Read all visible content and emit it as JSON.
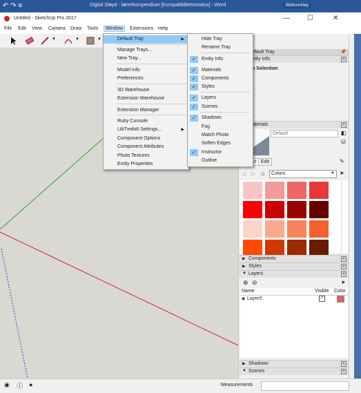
{
  "word_window": {
    "title": "Digital Sløyd - lærerkompendium [Kompatibilitetsmodus] - Word",
    "tools_tab": "Bildeverktøy",
    "quick_access": "↶ ↷ ≡"
  },
  "sketchup_window": {
    "title": "Untitled - SketchUp Pro 2017",
    "minimize": "—",
    "maximize": "☐",
    "close": "✕"
  },
  "menubar": [
    "File",
    "Edit",
    "View",
    "Camera",
    "Draw",
    "Tools",
    "Window",
    "Extensions",
    "Help"
  ],
  "window_menu": {
    "items": [
      {
        "label": "Default Tray",
        "submenu": true,
        "highlighted": true
      },
      {
        "label": "Manage Trays..."
      },
      {
        "label": "New Tray..."
      },
      {
        "label": "Model Info"
      },
      {
        "label": "Preferences"
      },
      {
        "label": "3D Warehouse"
      },
      {
        "label": "Extension Warehouse"
      },
      {
        "label": "Extension Manager"
      },
      {
        "label": "Ruby Console"
      },
      {
        "label": "LibTredo6 Settings...",
        "submenu": true
      },
      {
        "label": "Component Options"
      },
      {
        "label": "Component Attributes"
      },
      {
        "label": "Photo Textures"
      },
      {
        "label": "Entity Properties"
      }
    ]
  },
  "tray_submenu": {
    "items": [
      {
        "label": "Hide Tray",
        "checked": false
      },
      {
        "label": "Rename Tray",
        "checked": false
      },
      {
        "label": "Entity Info",
        "checked": true
      },
      {
        "label": "Materials",
        "checked": true
      },
      {
        "label": "Components",
        "checked": true
      },
      {
        "label": "Styles",
        "checked": true
      },
      {
        "label": "Layers",
        "checked": true
      },
      {
        "label": "Scenes",
        "checked": true
      },
      {
        "label": "Shadows",
        "checked": true
      },
      {
        "label": "Fog",
        "checked": false
      },
      {
        "label": "Match Photo",
        "checked": false
      },
      {
        "label": "Soften Edges",
        "checked": false
      },
      {
        "label": "Instructor",
        "checked": true
      },
      {
        "label": "Outline",
        "checked": false
      }
    ]
  },
  "tray": {
    "title": "Default Tray",
    "entity_info_title": "Entity Info",
    "selection_label": "No Selection",
    "materials_title": "Materials",
    "material_name": "Default",
    "tab_select": "Select",
    "tab_edit": "Edit",
    "colors_dropdown": "Colors",
    "swatch_colors": [
      "#f9c4c4",
      "#f49a9a",
      "#ef6666",
      "#ea3838",
      "#ff0000",
      "#cc0000",
      "#990000",
      "#660000",
      "#fdd3c9",
      "#f9a98f",
      "#f5845f",
      "#f4612f",
      "#ff4a00",
      "#cc3a00",
      "#992c00",
      "#661d00"
    ],
    "components_title": "Components",
    "styles_title": "Styles",
    "layers_title": "Layers",
    "layers_columns": [
      "Name",
      "Visible",
      "Color"
    ],
    "layers": [
      {
        "name": "Layer0",
        "visible": "✓",
        "color": "#e06060"
      }
    ],
    "shadows_title": "Shadows",
    "scenes_title": "Scenes"
  },
  "statusbar": {
    "measurements_label": "Measurements"
  },
  "colors": {
    "word_blue": "#2b579a",
    "menu_highlight": "#91c9f7",
    "axis_red": "#d0202a",
    "axis_green": "#2aa02a",
    "axis_blue": "#3040c0"
  }
}
